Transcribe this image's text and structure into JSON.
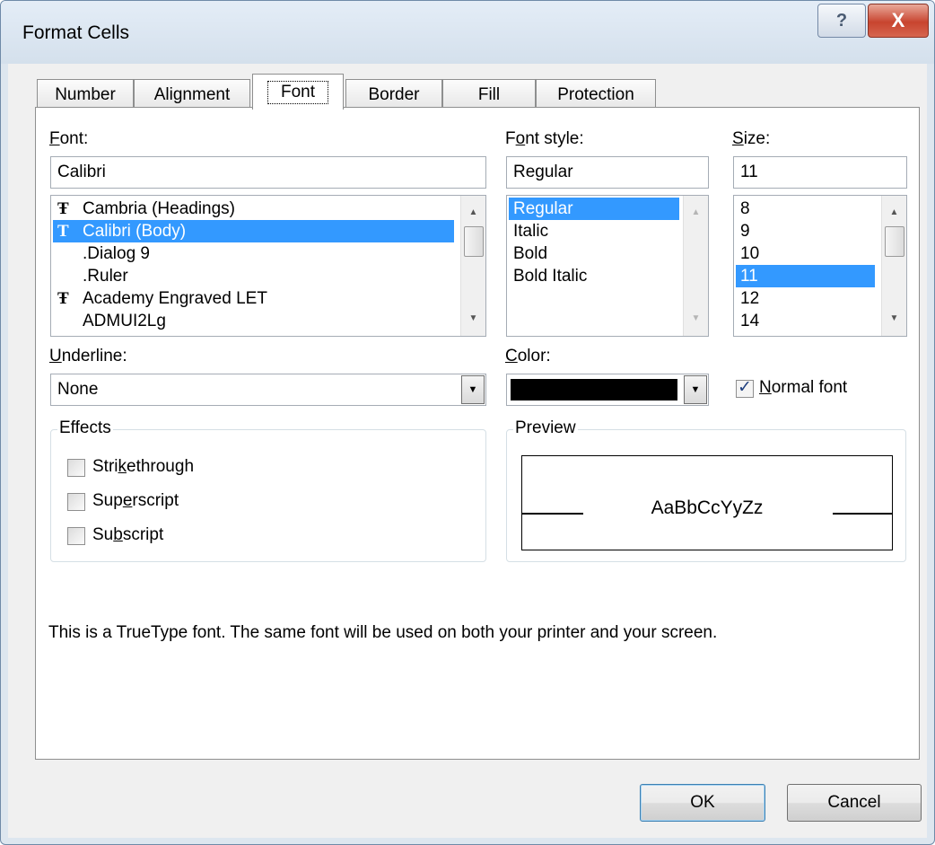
{
  "window": {
    "title": "Format Cells",
    "help_glyph": "?",
    "close_glyph": "X"
  },
  "tabs": [
    "Number",
    "Alignment",
    "Font",
    "Border",
    "Fill",
    "Protection"
  ],
  "active_tab": "Font",
  "font": {
    "label": "Font:",
    "label_hotkey": "F",
    "label_rest": "ont:",
    "value": "Calibri",
    "list": [
      {
        "icon": "truetype-icon",
        "name": "Cambria (Headings)"
      },
      {
        "icon": "truetype-icon",
        "name": "Calibri (Body)",
        "selected": true
      },
      {
        "icon": "",
        "name": ".Dialog 9"
      },
      {
        "icon": "",
        "name": ".Ruler"
      },
      {
        "icon": "truetype-icon",
        "name": "Academy Engraved LET"
      },
      {
        "icon": "",
        "name": "ADMUI2Lg"
      }
    ]
  },
  "font_style": {
    "label": "Font style:",
    "label_pre": "F",
    "label_hotkey": "o",
    "label_rest": "nt style:",
    "value": "Regular",
    "list": [
      "Regular",
      "Italic",
      "Bold",
      "Bold Italic"
    ],
    "selected": "Regular"
  },
  "size": {
    "label": "Size:",
    "label_hotkey": "S",
    "label_rest": "ize:",
    "value": "11",
    "list": [
      "8",
      "9",
      "10",
      "11",
      "12",
      "14"
    ],
    "selected": "11"
  },
  "underline": {
    "label": "Underline:",
    "label_hotkey": "U",
    "label_rest": "nderline:",
    "value": "None"
  },
  "color": {
    "label": "Color:",
    "label_hotkey": "C",
    "label_rest": "olor:",
    "swatch": "#000000"
  },
  "normal_font": {
    "label_hotkey": "N",
    "label_rest": "ormal font",
    "checked": true
  },
  "effects": {
    "title": "Effects",
    "items": [
      {
        "pre": "Stri",
        "hotkey": "k",
        "rest": "ethrough",
        "checked": false
      },
      {
        "pre": "Sup",
        "hotkey": "e",
        "rest": "rscript",
        "checked": false
      },
      {
        "pre": "Su",
        "hotkey": "b",
        "rest": "script",
        "checked": false
      }
    ]
  },
  "preview": {
    "title": "Preview",
    "sample": "AaBbCcYyZz"
  },
  "info_text": "This is a TrueType font.  The same font will be used on both your printer and your screen.",
  "buttons": {
    "ok": "OK",
    "cancel": "Cancel"
  }
}
